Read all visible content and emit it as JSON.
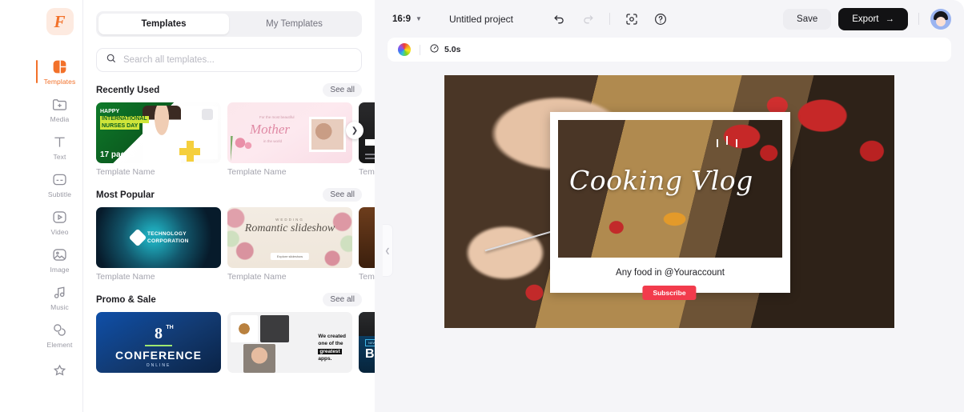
{
  "brand": {
    "logo_letter": "F",
    "logo_color": "#f2712a"
  },
  "sidebar": {
    "items": [
      {
        "label": "Templates",
        "icon": "templates-icon",
        "active": true
      },
      {
        "label": "Media",
        "icon": "media-folder-icon",
        "active": false
      },
      {
        "label": "Text",
        "icon": "text-icon",
        "active": false
      },
      {
        "label": "Subtitle",
        "icon": "subtitle-icon",
        "active": false
      },
      {
        "label": "Video",
        "icon": "video-icon",
        "active": false
      },
      {
        "label": "Image",
        "icon": "image-icon",
        "active": false
      },
      {
        "label": "Music",
        "icon": "music-icon",
        "active": false
      },
      {
        "label": "Element",
        "icon": "element-icon",
        "active": false
      },
      {
        "label": "",
        "icon": "magic-wand-icon",
        "active": false
      }
    ]
  },
  "panel": {
    "tabs": [
      {
        "label": "Templates",
        "active": true
      },
      {
        "label": "My Templates",
        "active": false
      }
    ],
    "search": {
      "placeholder": "Search all templates...",
      "value": "",
      "icon": "search-icon"
    },
    "see_all_label": "See all",
    "next_arrow": "chevron-right-icon",
    "sections": [
      {
        "title": "Recently Used",
        "cards": [
          {
            "caption": "Template Name",
            "art": "t-nurses",
            "text": {
              "happy": "HAPPY",
              "line1": "INTERNATIONAL",
              "line2": "NURSES DAY",
              "pages": "17 pages"
            }
          },
          {
            "caption": "Template Name",
            "art": "t-mother",
            "text": {
              "sub": "For the most beautiful",
              "title": "Mother",
              "sub2": "in the world"
            }
          },
          {
            "caption": "Templ",
            "art": "t-dark",
            "text": {}
          }
        ]
      },
      {
        "title": "Most Popular",
        "cards": [
          {
            "caption": "Template Name",
            "art": "t-tech",
            "text": {
              "line1": "TECHNOLOGY",
              "line2": "CORPORATION"
            }
          },
          {
            "caption": "Template Name",
            "art": "t-wed",
            "text": {
              "eyebrow": "WEDDING",
              "title": "Romantic slideshow",
              "button": "Explore slideshow"
            }
          },
          {
            "caption": "Templ",
            "art": "t-brown",
            "text": {}
          }
        ]
      },
      {
        "title": "Promo & Sale",
        "cards": [
          {
            "caption": "",
            "art": "t-conf",
            "text": {
              "number": "8",
              "ordinal": "TH",
              "title": "CONFERENCE",
              "sub": "ONLINE"
            }
          },
          {
            "caption": "",
            "art": "t-apps",
            "text": {
              "l1": "We created",
              "l2": "one of the",
              "l3": "greatest",
              "l4": "apps."
            }
          },
          {
            "caption": "",
            "art": "t-blue",
            "text": {
              "tag": "NEW ARRIVAL",
              "title": "BL"
            }
          }
        ]
      }
    ],
    "collapse_handle": "chevron-left-icon"
  },
  "editor": {
    "toolbar": {
      "aspect_ratio": "16:9",
      "aspect_caret": "chevron-down-icon",
      "project_name": "Untitled project",
      "undo_icon": "undo-icon",
      "redo_icon": "redo-icon",
      "fit_icon": "focus-frame-icon",
      "help_icon": "help-circle-icon",
      "save_label": "Save",
      "export_label": "Export",
      "export_arrow": "arrow-right-icon",
      "avatar": "user-avatar"
    },
    "timeline": {
      "color_wheel_icon": "color-wheel-icon",
      "clock_icon": "clock-icon",
      "duration": "5.0s"
    },
    "canvas": {
      "title": "Cooking Vlog",
      "caption": "Any food in @Youraccount",
      "subscribe_label": "Subscribe",
      "subscribe_color": "#f23b4c"
    }
  }
}
